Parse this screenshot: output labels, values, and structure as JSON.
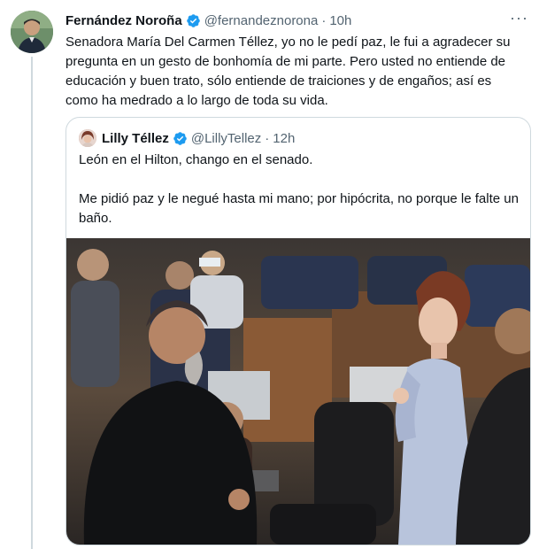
{
  "tweet": {
    "author_name": "Fernández Noroña",
    "handle": "@fernandeznorona",
    "separator": "·",
    "time": "10h",
    "more_label": "···",
    "text": "Senadora María Del Carmen Téllez, yo no le pedí paz, le fui a agradecer su pregunta en un gesto de bonhomía de mi parte. Pero usted no entiende de educación y buen trato, sólo entiende de traiciones y de engaños; así es como ha medrado a lo largo de toda su vida."
  },
  "quoted_tweet": {
    "author_name": "Lilly Téllez",
    "handle": "@LillyTellez",
    "separator": "·",
    "time": "12h",
    "paragraph_1": "León en el Hilton, chango en el senado.",
    "paragraph_2": "Me pidió paz y le negué hasta mi mano; por hipócrita, no porque le falte un baño."
  },
  "colors": {
    "verified": "#1d9bf0",
    "secondary_text": "#536471",
    "border": "#cfd9de"
  },
  "icons": {
    "verified": "verified-badge-icon",
    "more": "more-dots-icon"
  }
}
